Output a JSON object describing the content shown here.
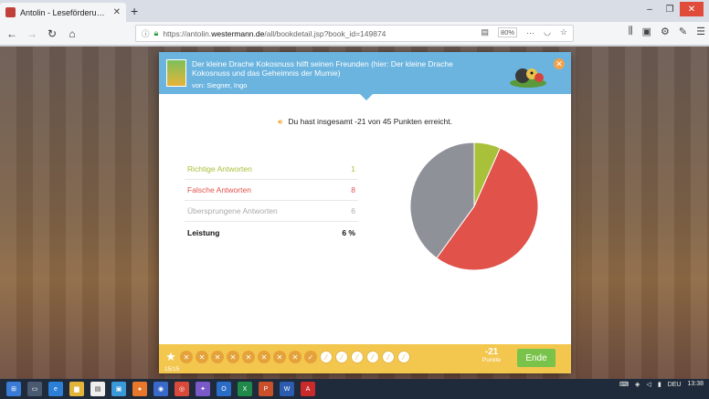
{
  "browser": {
    "tab_title": "Antolin - Leseförderung von M",
    "tab_close": "✕",
    "new_tab": "+",
    "url_prefix": "https://antolin.",
    "url_domain": "westermann.de",
    "url_path": "/all/bookdetail.jsp?book_id=149874",
    "zoom": "80%",
    "window_controls": {
      "minimize": "–",
      "maximize": "❐",
      "close": "✕"
    }
  },
  "book": {
    "title": "Der kleine Drache Kokosnuss hilft seinen Freunden (hier: Der kleine Drache Kokosnuss und das Geheimnis der Mumie)",
    "author": "von: Siegner, Ingo"
  },
  "result": {
    "summary": "Du hast insgesamt -21 von 45 Punkten erreicht.",
    "stats": [
      {
        "label": "Richtige Antworten",
        "value": "1"
      },
      {
        "label": "Falsche Antworten",
        "value": "8"
      },
      {
        "label": "Übersprungene Antworten",
        "value": "6"
      },
      {
        "label": "Leistung",
        "value": "6 %"
      }
    ]
  },
  "chart_data": {
    "type": "pie",
    "categories": [
      "Richtige Antworten",
      "Falsche Antworten",
      "Übersprungene Antworten"
    ],
    "values": [
      1,
      8,
      6
    ],
    "colors": [
      "#a8c03a",
      "#e0524a",
      "#8e9197"
    ]
  },
  "footer": {
    "progress": [
      "wrong",
      "wrong",
      "wrong",
      "wrong",
      "wrong",
      "wrong",
      "wrong",
      "wrong",
      "right",
      "skip",
      "skip",
      "skip",
      "skip",
      "skip",
      "skip"
    ],
    "counter": "15/15",
    "points_value": "-21",
    "points_label": "Punkte",
    "end_label": "Ende"
  },
  "taskbar": {
    "language": "DEU",
    "time": "13:38"
  },
  "colors": {
    "header_blue": "#6bb4df",
    "footer_yellow": "#f3c64e",
    "end_green": "#7ac34a",
    "correct": "#a8c03a",
    "wrong": "#e0524a",
    "skipped": "#8e9197"
  }
}
